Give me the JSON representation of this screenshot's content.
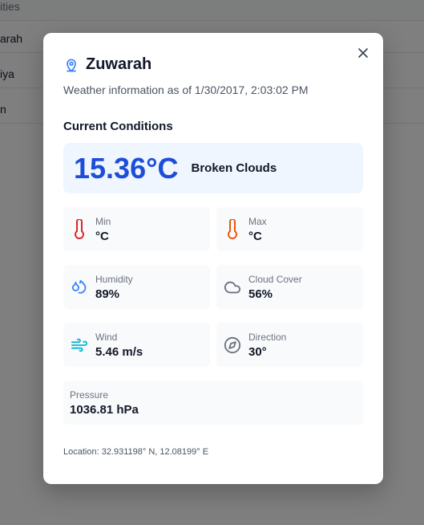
{
  "background": {
    "rows": [
      "ities",
      "arah",
      "iya",
      "n"
    ]
  },
  "modal": {
    "title": "Zuwarah",
    "subtitle": "Weather information as of 1/30/2017, 2:03:02 PM",
    "section_title": "Current Conditions",
    "temperature": "15.36°C",
    "condition": "Broken Clouds",
    "min": {
      "label": "Min",
      "value": "°C"
    },
    "max": {
      "label": "Max",
      "value": "°C"
    },
    "humidity": {
      "label": "Humidity",
      "value": "89%"
    },
    "cloud_cover": {
      "label": "Cloud Cover",
      "value": "56%"
    },
    "wind": {
      "label": "Wind",
      "value": "5.46 m/s"
    },
    "direction": {
      "label": "Direction",
      "value": "30°"
    },
    "pressure": {
      "label": "Pressure",
      "value": "1036.81 hPa"
    },
    "location": "Location: 32.931198° N, 12.08199° E"
  },
  "colors": {
    "accent_blue": "#1d4ed8",
    "min_icon": "#dc2626",
    "max_icon": "#ea580c",
    "humidity_icon": "#3b82f6",
    "wind_icon": "#06b6d4",
    "neutral_icon": "#6b7280"
  }
}
